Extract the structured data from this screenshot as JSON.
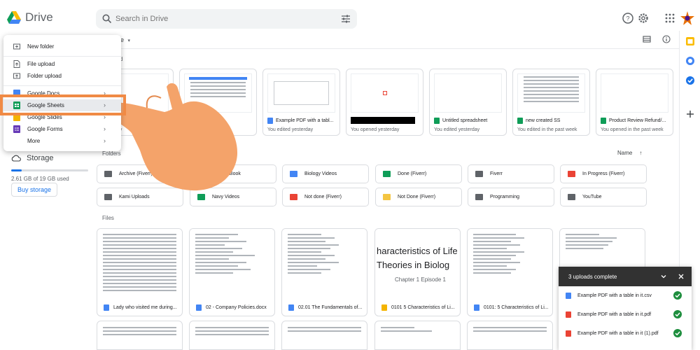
{
  "app": {
    "name": "Drive"
  },
  "search": {
    "placeholder": "Search in Drive"
  },
  "sidebar": {
    "storage_label": "Storage",
    "storage_used": "2.61 GB of 19 GB used",
    "storage_fraction": 0.137,
    "buy_label": "Buy storage"
  },
  "new_menu": {
    "items": [
      {
        "label": "New folder"
      },
      {
        "label": "File upload"
      },
      {
        "label": "Folder upload"
      },
      {
        "label": "Google Docs"
      },
      {
        "label": "Google Sheets"
      },
      {
        "label": "Google Slides"
      },
      {
        "label": "Google Forms"
      },
      {
        "label": "More"
      }
    ]
  },
  "main": {
    "breadcrumb_tail": "e",
    "suggested_label": "d",
    "quick_access": [
      {
        "name": "Example PDF with a tabl...",
        "sub": "yesterday"
      },
      {
        "name": "",
        "sub": ""
      },
      {
        "name": "Example PDF with a tabl...",
        "sub": "You edited yesterday"
      },
      {
        "name": "",
        "sub": "You opened yesterday"
      },
      {
        "name": "Untitled spreadsheet",
        "sub": "You edited yesterday"
      },
      {
        "name": "new created SS",
        "sub": "You edited in the past week"
      },
      {
        "name": "Product Review Refund/...",
        "sub": "You opened in the past week"
      }
    ],
    "folders_label": "Folders",
    "sort_label": "Name",
    "folders": [
      {
        "name": "Archive (Fiverr)"
      },
      {
        "name": "Biology Book"
      },
      {
        "name": "Biology Videos"
      },
      {
        "name": "Done (Fiverr)"
      },
      {
        "name": "Fiverr"
      },
      {
        "name": "In Progress (Fiverr)"
      },
      {
        "name": "Kami Uploads"
      },
      {
        "name": "Navy Videos"
      },
      {
        "name": "Not done (Fiverr)"
      },
      {
        "name": "Not Done (Fiverr)"
      },
      {
        "name": "Programming"
      },
      {
        "name": "YouTube"
      }
    ],
    "files_label": "Files",
    "files": [
      {
        "name": "Lady who visited me during..."
      },
      {
        "name": "02 - Company Policies.docx"
      },
      {
        "name": "02.01 The Fundamentals of..."
      },
      {
        "name": "0101 5 Characteristics of Li..."
      },
      {
        "name": "0101: 5 Characteristics of Li..."
      },
      {
        "name": ""
      }
    ],
    "slide_thumb_line1": "haracteristics of Life",
    "slide_thumb_line2": "Theories in Biolog",
    "slide_thumb_line3": "Chapter 1 Episode 1"
  },
  "uploads": {
    "title": "3 uploads complete",
    "items": [
      {
        "name": "Example PDF with a table in it.csv",
        "type": "csv"
      },
      {
        "name": "Example PDF with a table in it.pdf",
        "type": "pdf"
      },
      {
        "name": "Example PDF with a table in it (1).pdf",
        "type": "pdf"
      }
    ]
  },
  "colors": {
    "accent": "#1a73e8",
    "highlight": "#f08a45",
    "hand": "#f4a36a",
    "folder_grey": "#5f6368",
    "folder_blue": "#4285f4",
    "folder_green": "#0f9d58",
    "folder_red": "#ea4335",
    "folder_yellow": "#f4c542"
  }
}
